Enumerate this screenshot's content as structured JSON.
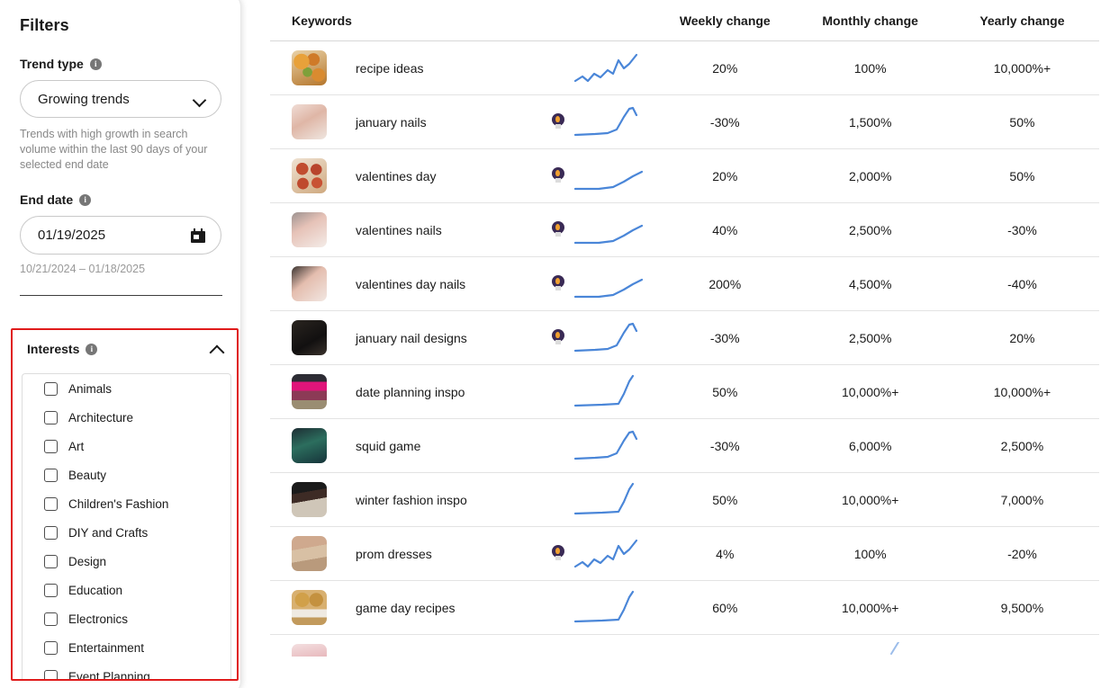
{
  "filters": {
    "title": "Filters",
    "trend_type": {
      "label": "Trend type",
      "info_glyph": "i",
      "selected": "Growing trends",
      "helper": "Trends with high growth in search volume within the last 90 days of your selected end date"
    },
    "end_date": {
      "label": "End date",
      "info_glyph": "i",
      "value": "01/19/2025",
      "range": "10/21/2024 – 01/18/2025"
    },
    "interests": {
      "label": "Interests",
      "info_glyph": "i",
      "highlight_color": "#e01b1b",
      "items": [
        {
          "label": "Animals",
          "checked": false
        },
        {
          "label": "Architecture",
          "checked": false
        },
        {
          "label": "Art",
          "checked": false
        },
        {
          "label": "Beauty",
          "checked": false
        },
        {
          "label": "Children's Fashion",
          "checked": false
        },
        {
          "label": "DIY and Crafts",
          "checked": false
        },
        {
          "label": "Design",
          "checked": false
        },
        {
          "label": "Education",
          "checked": false
        },
        {
          "label": "Electronics",
          "checked": false
        },
        {
          "label": "Entertainment",
          "checked": false
        },
        {
          "label": "Event Planning",
          "checked": false
        }
      ]
    }
  },
  "table": {
    "columns": [
      "Keywords",
      "Weekly change",
      "Monthly change",
      "Yearly change"
    ],
    "rows": [
      {
        "keyword": "recipe ideas",
        "thumb": "t-recipe",
        "badge": false,
        "spark": "wavy-up",
        "weekly": "20%",
        "monthly": "100%",
        "yearly": "10,000%+"
      },
      {
        "keyword": "january nails",
        "thumb": "t-hand1",
        "badge": true,
        "spark": "flat-spike",
        "weekly": "-30%",
        "monthly": "1,500%",
        "yearly": "50%"
      },
      {
        "keyword": "valentines day",
        "thumb": "t-valday",
        "badge": true,
        "spark": "flat-rise",
        "weekly": "20%",
        "monthly": "2,000%",
        "yearly": "50%"
      },
      {
        "keyword": "valentines nails",
        "thumb": "t-hand2",
        "badge": true,
        "spark": "flat-rise",
        "weekly": "40%",
        "monthly": "2,500%",
        "yearly": "-30%"
      },
      {
        "keyword": "valentines day nails",
        "thumb": "t-hand3",
        "badge": true,
        "spark": "flat-rise",
        "weekly": "200%",
        "monthly": "4,500%",
        "yearly": "-40%"
      },
      {
        "keyword": "january nail designs",
        "thumb": "t-nailbook",
        "badge": true,
        "spark": "flat-spike",
        "weekly": "-30%",
        "monthly": "2,500%",
        "yearly": "20%"
      },
      {
        "keyword": "date planning inspo",
        "thumb": "t-datenight",
        "badge": false,
        "spark": "flat-jump",
        "weekly": "50%",
        "monthly": "10,000%+",
        "yearly": "10,000%+"
      },
      {
        "keyword": "squid game",
        "thumb": "t-squid",
        "badge": false,
        "spark": "flat-spike",
        "weekly": "-30%",
        "monthly": "6,000%",
        "yearly": "2,500%"
      },
      {
        "keyword": "winter fashion inspo",
        "thumb": "t-winter",
        "badge": false,
        "spark": "flat-jump",
        "weekly": "50%",
        "monthly": "10,000%+",
        "yearly": "7,000%"
      },
      {
        "keyword": "prom dresses",
        "thumb": "t-prom",
        "badge": true,
        "spark": "wavy-up",
        "weekly": "4%",
        "monthly": "100%",
        "yearly": "-20%"
      },
      {
        "keyword": "game day recipes",
        "thumb": "t-sliders",
        "badge": false,
        "spark": "flat-jump",
        "weekly": "60%",
        "monthly": "10,000%+",
        "yearly": "9,500%"
      }
    ],
    "partial_row": {
      "keyword": "",
      "thumb": "t-partial"
    }
  },
  "colors": {
    "sparkline": "#4a86d8",
    "highlight": "#e01b1b",
    "text": "#1a1a1a",
    "muted": "#888888"
  }
}
